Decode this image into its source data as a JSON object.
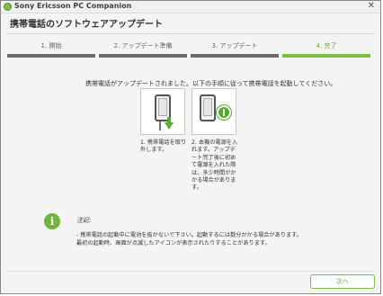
{
  "window": {
    "app_title": "Sony Ericsson PC Companion",
    "close_glyph": "✕"
  },
  "header": {
    "title": "携帯電話のソフトウェアアップデート"
  },
  "steps": [
    {
      "label": "1. 開始"
    },
    {
      "label": "2. アップデート準備"
    },
    {
      "label": "3. アップデート"
    },
    {
      "label": "4. 完了",
      "active": true
    }
  ],
  "main": {
    "instruction": "携帯電話がアップデートされました。以下の手順に従って携帯電話を起動してください。",
    "illustrations": [
      {
        "icon": "phone-unplug-icon",
        "caption": "1. 携帯電話を取り外します。"
      },
      {
        "icon": "phone-power-icon",
        "caption": "2. 本機の電源を入れます。アップデート完了後に初めて電源を入れた際は、多少時間がかかる場合があります。"
      }
    ]
  },
  "note": {
    "icon": "info-icon",
    "icon_glyph": "i",
    "title": "注記:",
    "line1": "- 携帯電話の起動中に電池を抜かないで下さい。起動するには数分かかる場合があります。",
    "line2": "最初の起動時、画面が点滅したアイコンが表示されたりすることがあります。"
  },
  "footer": {
    "next_label": "次へ"
  },
  "colors": {
    "accent": "#7bbf44",
    "step_bar": "#6c6c6c"
  }
}
